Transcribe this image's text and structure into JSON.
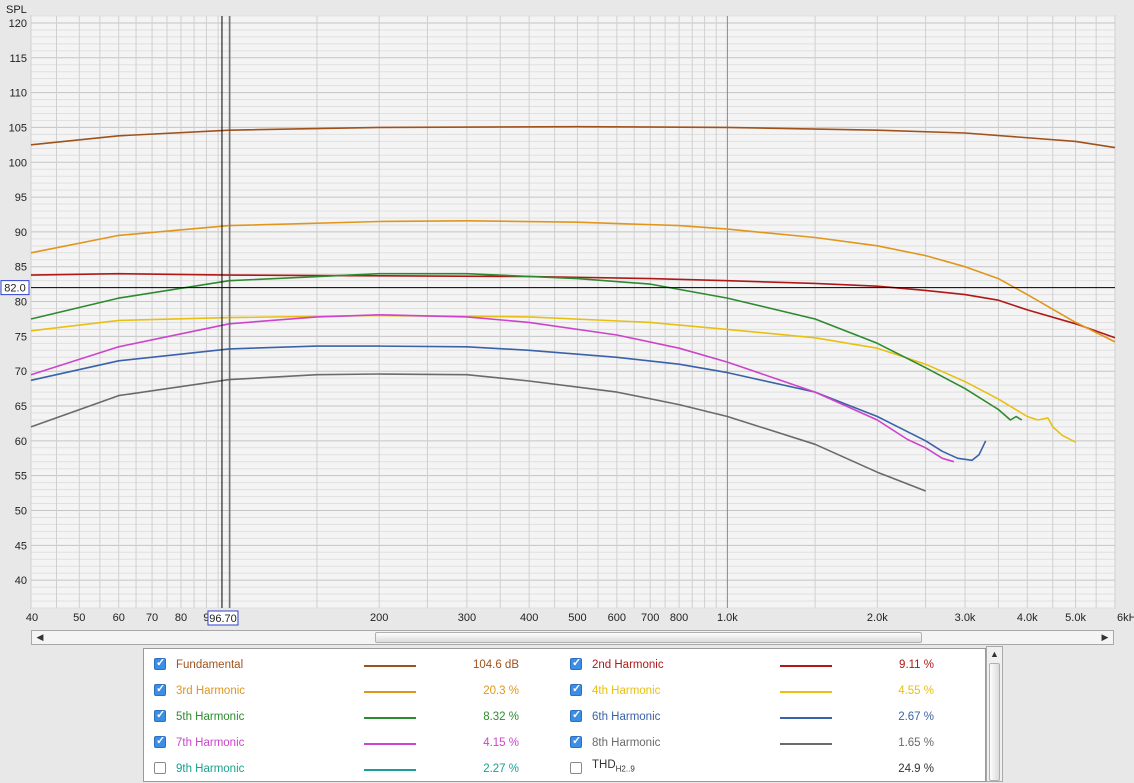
{
  "chart_data": {
    "type": "line",
    "ylabel": "SPL",
    "x_scale": "log",
    "xlim": [
      40,
      6000
    ],
    "ylim": [
      36,
      121
    ],
    "grid": true,
    "x_ticks": [
      {
        "v": 40,
        "label": "40"
      },
      {
        "v": 50,
        "label": "50"
      },
      {
        "v": 60,
        "label": "60"
      },
      {
        "v": 70,
        "label": "70"
      },
      {
        "v": 80,
        "label": "80"
      },
      {
        "v": 90,
        "label": "9"
      },
      {
        "v": 200,
        "label": "200"
      },
      {
        "v": 300,
        "label": "300"
      },
      {
        "v": 400,
        "label": "400"
      },
      {
        "v": 500,
        "label": "500"
      },
      {
        "v": 600,
        "label": "600"
      },
      {
        "v": 700,
        "label": "700"
      },
      {
        "v": 800,
        "label": "800"
      },
      {
        "v": 1000,
        "label": "1.0k"
      },
      {
        "v": 2000,
        "label": "2.0k"
      },
      {
        "v": 3000,
        "label": "3.0k"
      },
      {
        "v": 4000,
        "label": "4.0k"
      },
      {
        "v": 5000,
        "label": "5.0k"
      },
      {
        "v": 6000,
        "label": "6kHz"
      }
    ],
    "y_ticks": [
      "40",
      "45",
      "50",
      "55",
      "60",
      "65",
      "70",
      "75",
      "80",
      "85",
      "90",
      "95",
      "100",
      "105",
      "110",
      "115",
      "120"
    ],
    "cursor": {
      "x": 96.7,
      "x_label": "96.70",
      "y": 82.0,
      "y_label": "82.0"
    },
    "series": [
      {
        "name": "Fundamental",
        "color": "#a0521c",
        "points": [
          [
            40,
            102.5
          ],
          [
            60,
            103.8
          ],
          [
            100,
            104.6
          ],
          [
            200,
            105.0
          ],
          [
            500,
            105.1
          ],
          [
            1000,
            105.0
          ],
          [
            2000,
            104.6
          ],
          [
            3000,
            104.2
          ],
          [
            5000,
            103.0
          ],
          [
            6000,
            102.1
          ]
        ]
      },
      {
        "name": "2nd Harmonic",
        "color": "#b01818",
        "points": [
          [
            40,
            83.8
          ],
          [
            60,
            84.0
          ],
          [
            100,
            83.8
          ],
          [
            200,
            83.7
          ],
          [
            400,
            83.6
          ],
          [
            700,
            83.3
          ],
          [
            1000,
            83.0
          ],
          [
            1500,
            82.6
          ],
          [
            2000,
            82.2
          ],
          [
            2500,
            81.6
          ],
          [
            3000,
            81.0
          ],
          [
            3500,
            80.2
          ],
          [
            4000,
            78.8
          ],
          [
            5000,
            76.8
          ],
          [
            6000,
            74.8
          ]
        ]
      },
      {
        "name": "3rd Harmonic",
        "color": "#e0961c",
        "points": [
          [
            40,
            87.0
          ],
          [
            60,
            89.5
          ],
          [
            100,
            90.9
          ],
          [
            200,
            91.5
          ],
          [
            300,
            91.6
          ],
          [
            500,
            91.4
          ],
          [
            800,
            90.9
          ],
          [
            1000,
            90.4
          ],
          [
            1500,
            89.2
          ],
          [
            2000,
            88.0
          ],
          [
            2500,
            86.6
          ],
          [
            3000,
            85.0
          ],
          [
            3500,
            83.3
          ],
          [
            4000,
            81.0
          ],
          [
            5000,
            77.0
          ],
          [
            6000,
            74.2
          ]
        ]
      },
      {
        "name": "4th Harmonic",
        "color": "#e8c012",
        "points": [
          [
            40,
            75.8
          ],
          [
            60,
            77.3
          ],
          [
            100,
            77.7
          ],
          [
            200,
            78.0
          ],
          [
            400,
            77.8
          ],
          [
            700,
            77.0
          ],
          [
            1000,
            76.0
          ],
          [
            1500,
            74.8
          ],
          [
            2000,
            73.3
          ],
          [
            2500,
            71.0
          ],
          [
            3000,
            68.5
          ],
          [
            3500,
            66.0
          ],
          [
            4000,
            63.5
          ],
          [
            4200,
            63.0
          ],
          [
            4400,
            63.3
          ],
          [
            4500,
            62.0
          ],
          [
            4700,
            60.8
          ],
          [
            5000,
            59.8
          ]
        ]
      },
      {
        "name": "5th Harmonic",
        "color": "#2e8a2e",
        "points": [
          [
            40,
            77.5
          ],
          [
            60,
            80.5
          ],
          [
            100,
            83.0
          ],
          [
            200,
            84.0
          ],
          [
            300,
            84.0
          ],
          [
            500,
            83.3
          ],
          [
            700,
            82.5
          ],
          [
            1000,
            80.5
          ],
          [
            1500,
            77.5
          ],
          [
            2000,
            74.0
          ],
          [
            2500,
            70.5
          ],
          [
            3000,
            67.5
          ],
          [
            3500,
            64.5
          ],
          [
            3700,
            63.0
          ],
          [
            3800,
            63.5
          ],
          [
            3900,
            63.0
          ]
        ]
      },
      {
        "name": "6th Harmonic",
        "color": "#3a62a8",
        "points": [
          [
            40,
            68.7
          ],
          [
            60,
            71.5
          ],
          [
            100,
            73.2
          ],
          [
            150,
            73.6
          ],
          [
            200,
            73.6
          ],
          [
            300,
            73.5
          ],
          [
            400,
            73.0
          ],
          [
            600,
            72.0
          ],
          [
            800,
            71.0
          ],
          [
            1000,
            69.8
          ],
          [
            1500,
            67.0
          ],
          [
            2000,
            63.5
          ],
          [
            2500,
            60.0
          ],
          [
            2700,
            58.5
          ],
          [
            2900,
            57.5
          ],
          [
            3100,
            57.2
          ],
          [
            3200,
            58.0
          ],
          [
            3300,
            60.0
          ]
        ]
      },
      {
        "name": "7th Harmonic",
        "color": "#cc44cc",
        "points": [
          [
            40,
            69.5
          ],
          [
            60,
            73.5
          ],
          [
            100,
            76.8
          ],
          [
            150,
            77.8
          ],
          [
            200,
            78.1
          ],
          [
            300,
            77.8
          ],
          [
            400,
            77.0
          ],
          [
            600,
            75.2
          ],
          [
            800,
            73.3
          ],
          [
            1000,
            71.3
          ],
          [
            1500,
            67.0
          ],
          [
            2000,
            63.0
          ],
          [
            2300,
            60.2
          ],
          [
            2500,
            59.0
          ],
          [
            2700,
            57.5
          ],
          [
            2850,
            57.0
          ]
        ]
      },
      {
        "name": "8th Harmonic",
        "color": "#6a6a6a",
        "points": [
          [
            40,
            62.0
          ],
          [
            60,
            66.5
          ],
          [
            100,
            68.8
          ],
          [
            150,
            69.5
          ],
          [
            200,
            69.6
          ],
          [
            300,
            69.5
          ],
          [
            400,
            68.6
          ],
          [
            600,
            67.0
          ],
          [
            800,
            65.2
          ],
          [
            1000,
            63.5
          ],
          [
            1500,
            59.5
          ],
          [
            2000,
            55.5
          ],
          [
            2500,
            52.8
          ]
        ]
      }
    ]
  },
  "legend": {
    "rows": [
      [
        {
          "label": "Fundamental",
          "color": "#a0521c",
          "value": "104.6 dB",
          "checked": true
        },
        {
          "label": "2nd Harmonic",
          "color": "#b01818",
          "value": "9.11 %",
          "checked": true
        }
      ],
      [
        {
          "label": "3rd Harmonic",
          "color": "#e0961c",
          "value": "20.3 %",
          "checked": true
        },
        {
          "label": "4th Harmonic",
          "color": "#e8c012",
          "value": "4.55 %",
          "checked": true
        }
      ],
      [
        {
          "label": "5th Harmonic",
          "color": "#2e8a2e",
          "value": "8.32 %",
          "checked": true
        },
        {
          "label": "6th Harmonic",
          "color": "#3a62a8",
          "value": "2.67 %",
          "checked": true
        }
      ],
      [
        {
          "label": "7th Harmonic",
          "color": "#cc44cc",
          "value": "4.15 %",
          "checked": true
        },
        {
          "label": "8th Harmonic",
          "color": "#6a6a6a",
          "value": "1.65 %",
          "checked": true
        }
      ],
      [
        {
          "label": "9th Harmonic",
          "color": "#1aa090",
          "value": "2.27 %",
          "checked": false
        },
        {
          "label": "THD",
          "sub": "H2..9",
          "color": "#333333",
          "value": "24.9 %",
          "checked": false
        }
      ]
    ]
  }
}
